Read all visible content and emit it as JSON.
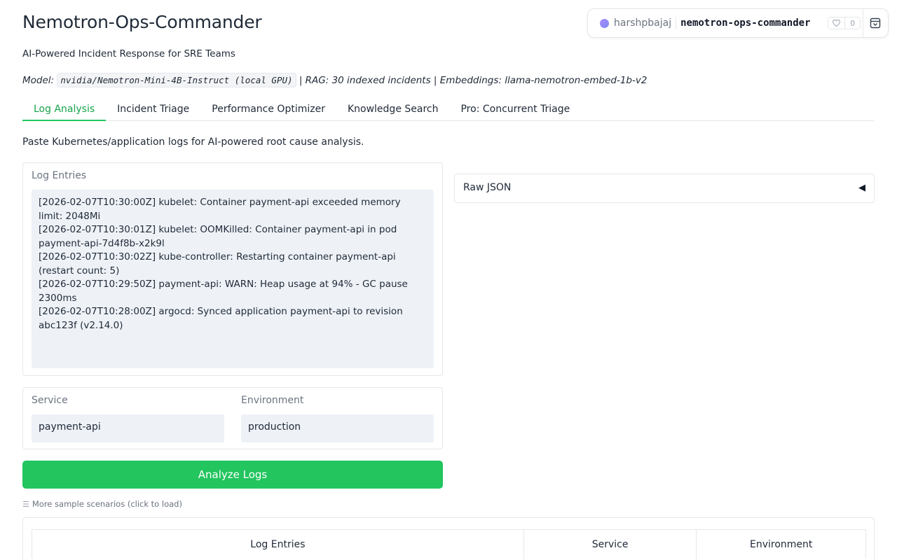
{
  "header": {
    "title": "Nemotron-Ops-Commander",
    "subtitle": "AI-Powered Incident Response for SRE Teams",
    "model_prefix": "Model:",
    "model_name": "nvidia/Nemotron-Mini-4B-Instruct (local GPU)",
    "model_suffix": "| RAG: 30 indexed incidents | Embeddings: llama-nemotron-embed-1b-v2"
  },
  "space_badge": {
    "user": "harshpbajaj",
    "repo": "nemotron-ops-commander",
    "likes": "0",
    "icons": [
      "avatar-dot",
      "heart-icon",
      "collapse-icon"
    ]
  },
  "tabs": [
    {
      "label": "Log Analysis",
      "active": true
    },
    {
      "label": "Incident Triage",
      "active": false
    },
    {
      "label": "Performance Optimizer",
      "active": false
    },
    {
      "label": "Knowledge Search",
      "active": false
    },
    {
      "label": "Pro: Concurrent Triage",
      "active": false
    }
  ],
  "log_analysis": {
    "description": "Paste Kubernetes/application logs for AI-powered root cause analysis.",
    "log_label": "Log Entries",
    "log_value": "[2026-02-07T10:30:00Z] kubelet: Container payment-api exceeded memory limit: 2048Mi\n[2026-02-07T10:30:01Z] kubelet: OOMKilled: Container payment-api in pod payment-api-7d4f8b-x2k9l\n[2026-02-07T10:30:02Z] kube-controller: Restarting container payment-api (restart count: 5)\n[2026-02-07T10:29:50Z] payment-api: WARN: Heap usage at 94% - GC pause 2300ms\n[2026-02-07T10:28:00Z] argocd: Synced application payment-api to revision abc123f (v2.14.0)",
    "service_label": "Service",
    "service_value": "payment-api",
    "environment_label": "Environment",
    "environment_value": "production",
    "analyze_button": "Analyze Logs",
    "samples_label": "More sample scenarios (click to load)",
    "raw_json_label": "Raw JSON",
    "table_headers": [
      "Log Entries",
      "Service",
      "Environment"
    ]
  },
  "colors": {
    "accent": "#22c55e",
    "active_tab_text": "#16a34a",
    "input_bg": "#eef2f7"
  }
}
